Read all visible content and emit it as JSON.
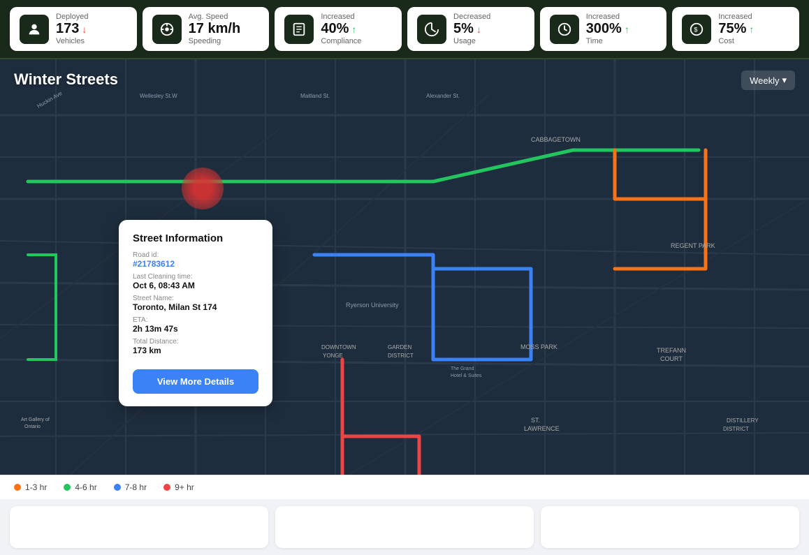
{
  "stats": [
    {
      "id": "vehicles",
      "label": "Vehicles",
      "sub_label": "Deployed",
      "value": "173",
      "trend": "down",
      "icon": "👤"
    },
    {
      "id": "speeding",
      "label": "Speeding",
      "sub_label": "Avg. Speed",
      "value": "17 km/h",
      "trend": "none",
      "icon": "🎛️"
    },
    {
      "id": "compliance",
      "label": "Compliance",
      "sub_label": "Increased",
      "value": "40%",
      "trend": "up",
      "icon": "📋"
    },
    {
      "id": "usage",
      "label": "Usage",
      "sub_label": "Decreased",
      "value": "5%",
      "trend": "down",
      "icon": "🔄"
    },
    {
      "id": "time",
      "label": "Time",
      "sub_label": "Increased",
      "value": "300%",
      "trend": "up",
      "icon": "🕐"
    },
    {
      "id": "cost",
      "label": "Cost",
      "sub_label": "Increased",
      "value": "75%",
      "trend": "up",
      "icon": "💲"
    }
  ],
  "map": {
    "title": "Winter Streets",
    "toggle_label": "Weekly",
    "popup": {
      "title": "Street Information",
      "road_id_label": "Road id:",
      "road_id_value": "#21783612",
      "cleaning_time_label": "Last Cleaning time:",
      "cleaning_time_value": "Oct 6, 08:43 AM",
      "street_name_label": "Street Name:",
      "street_name_value": "Toronto, Milan St 174",
      "eta_label": "ETA:",
      "eta_value": "2h 13m 47s",
      "distance_label": "Total Distance:",
      "distance_value": "173 km",
      "btn_label": "View More Details"
    }
  },
  "legend": [
    {
      "label": "1-3 hr",
      "color": "#f97316"
    },
    {
      "label": "4-6 hr",
      "color": "#22c55e"
    },
    {
      "label": "7-8 hr",
      "color": "#3b82f6"
    },
    {
      "label": "9+ hr",
      "color": "#ef4444"
    }
  ]
}
